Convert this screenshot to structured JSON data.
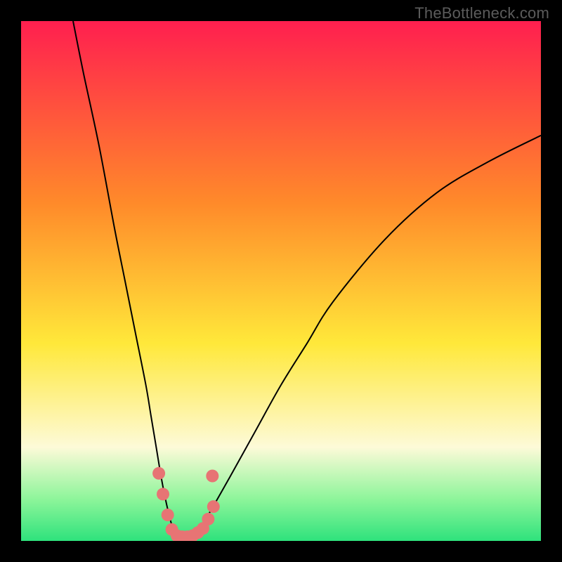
{
  "watermark": "TheBottleneck.com",
  "colors": {
    "bg": "#000000",
    "gradient_top": "#ff1f4f",
    "gradient_mid_top": "#ff8a2a",
    "gradient_mid": "#ffe83a",
    "gradient_mid_low": "#fdfad8",
    "gradient_low": "#8df59a",
    "gradient_bottom": "#2ee27c",
    "curve": "#000000",
    "marker": "#e77474",
    "watermark": "#5b5b5b"
  },
  "chart_data": {
    "type": "line",
    "title": "",
    "xlabel": "",
    "ylabel": "",
    "xlim": [
      0,
      100
    ],
    "ylim": [
      0,
      100
    ],
    "curve": {
      "vertex_x": 30,
      "vertex_y": 0,
      "points": [
        {
          "x": 10,
          "y": 100
        },
        {
          "x": 12,
          "y": 90
        },
        {
          "x": 15,
          "y": 76
        },
        {
          "x": 18,
          "y": 60
        },
        {
          "x": 20,
          "y": 50
        },
        {
          "x": 22,
          "y": 40
        },
        {
          "x": 24,
          "y": 30
        },
        {
          "x": 25,
          "y": 24
        },
        {
          "x": 26,
          "y": 18
        },
        {
          "x": 27,
          "y": 12
        },
        {
          "x": 28,
          "y": 7
        },
        {
          "x": 29,
          "y": 3
        },
        {
          "x": 30,
          "y": 0
        },
        {
          "x": 32,
          "y": 0
        },
        {
          "x": 34,
          "y": 2
        },
        {
          "x": 36,
          "y": 5
        },
        {
          "x": 40,
          "y": 12
        },
        {
          "x": 45,
          "y": 21
        },
        {
          "x": 50,
          "y": 30
        },
        {
          "x": 55,
          "y": 38
        },
        {
          "x": 60,
          "y": 46
        },
        {
          "x": 70,
          "y": 58
        },
        {
          "x": 80,
          "y": 67
        },
        {
          "x": 90,
          "y": 73
        },
        {
          "x": 100,
          "y": 78
        }
      ]
    },
    "markers": [
      {
        "x": 26.5,
        "y": 13
      },
      {
        "x": 27.3,
        "y": 9
      },
      {
        "x": 28.2,
        "y": 5
      },
      {
        "x": 29.0,
        "y": 2.2
      },
      {
        "x": 30.0,
        "y": 1.0
      },
      {
        "x": 31.0,
        "y": 0.8
      },
      {
        "x": 32.0,
        "y": 0.8
      },
      {
        "x": 33.0,
        "y": 1.0
      },
      {
        "x": 34.0,
        "y": 1.6
      },
      {
        "x": 35.0,
        "y": 2.4
      },
      {
        "x": 36.0,
        "y": 4.2
      },
      {
        "x": 37.0,
        "y": 6.6
      },
      {
        "x": 36.8,
        "y": 12.5
      }
    ]
  }
}
